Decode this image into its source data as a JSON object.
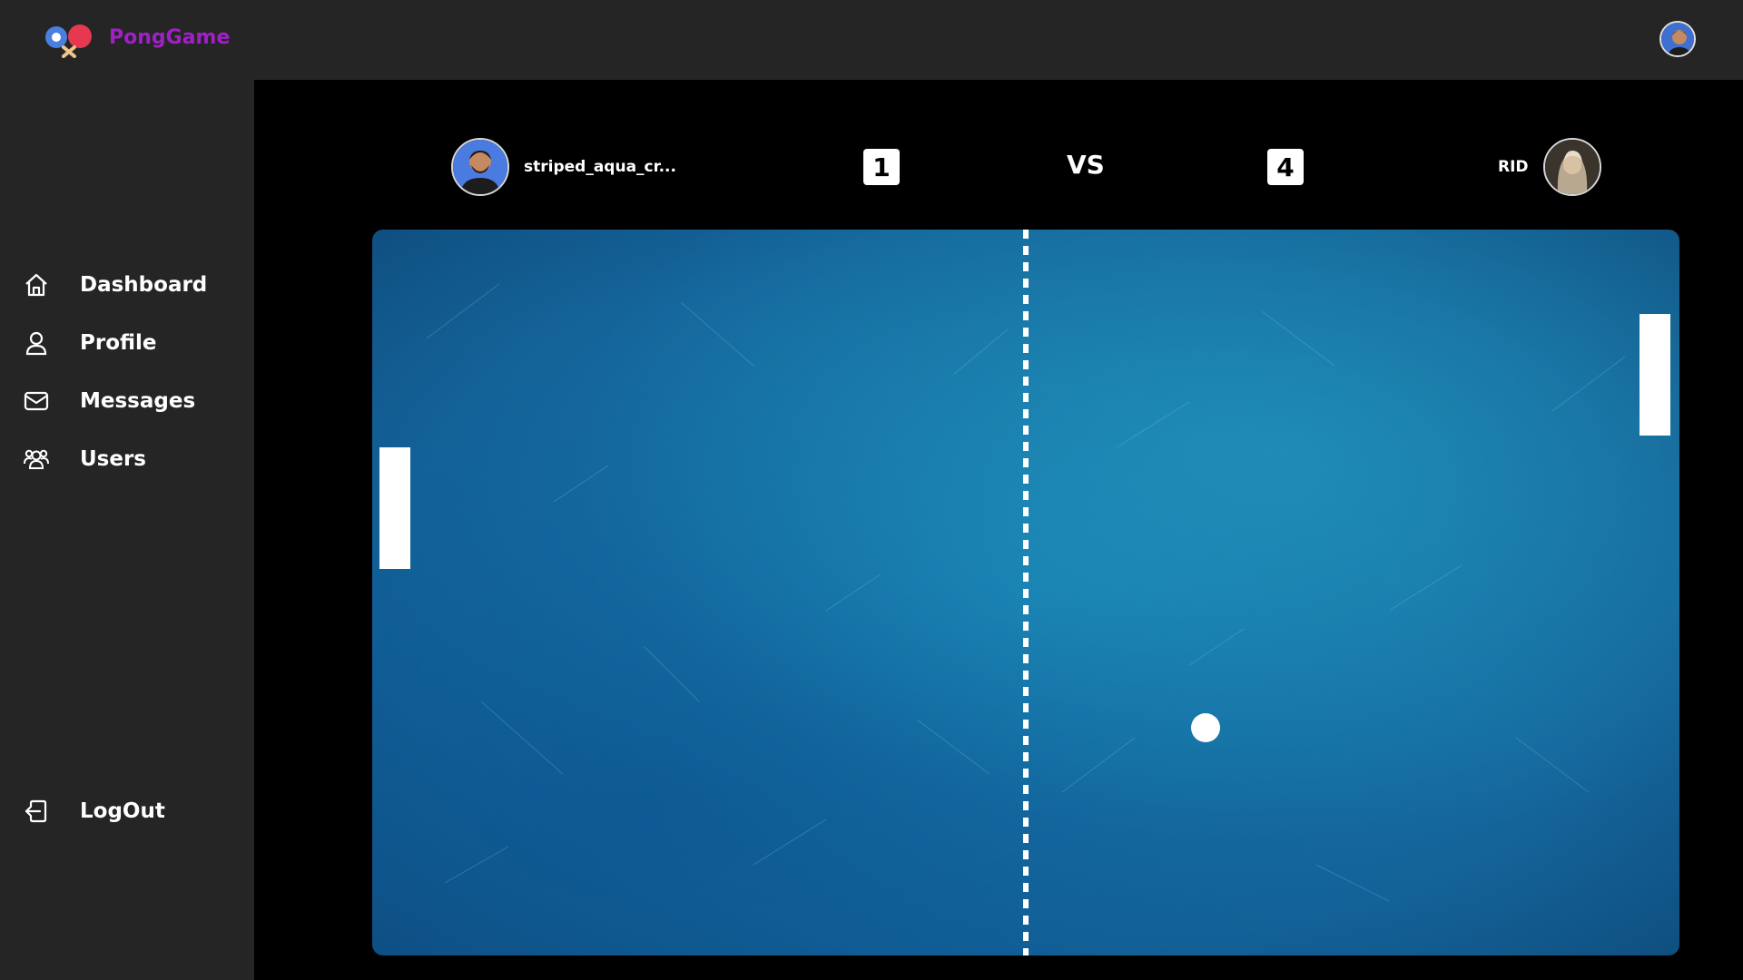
{
  "app": {
    "brand": "PongGame",
    "logo_icon": "ping-pong-logo-icon",
    "colors": {
      "brand": "#a020c8",
      "background": "#252525",
      "main": "#000000",
      "field": "#1774a8"
    }
  },
  "sidebar": {
    "items": [
      {
        "label": "Dashboard",
        "icon": "home-icon"
      },
      {
        "label": "Profile",
        "icon": "user-icon"
      },
      {
        "label": "Messages",
        "icon": "mail-icon"
      },
      {
        "label": "Users",
        "icon": "users-icon"
      }
    ],
    "logout": {
      "label": "LogOut",
      "icon": "logout-icon"
    }
  },
  "game": {
    "player1": {
      "name": "striped_aqua_cr...",
      "score": "1"
    },
    "player2": {
      "name": "RID",
      "score": "4"
    },
    "vs_label": "VS"
  }
}
